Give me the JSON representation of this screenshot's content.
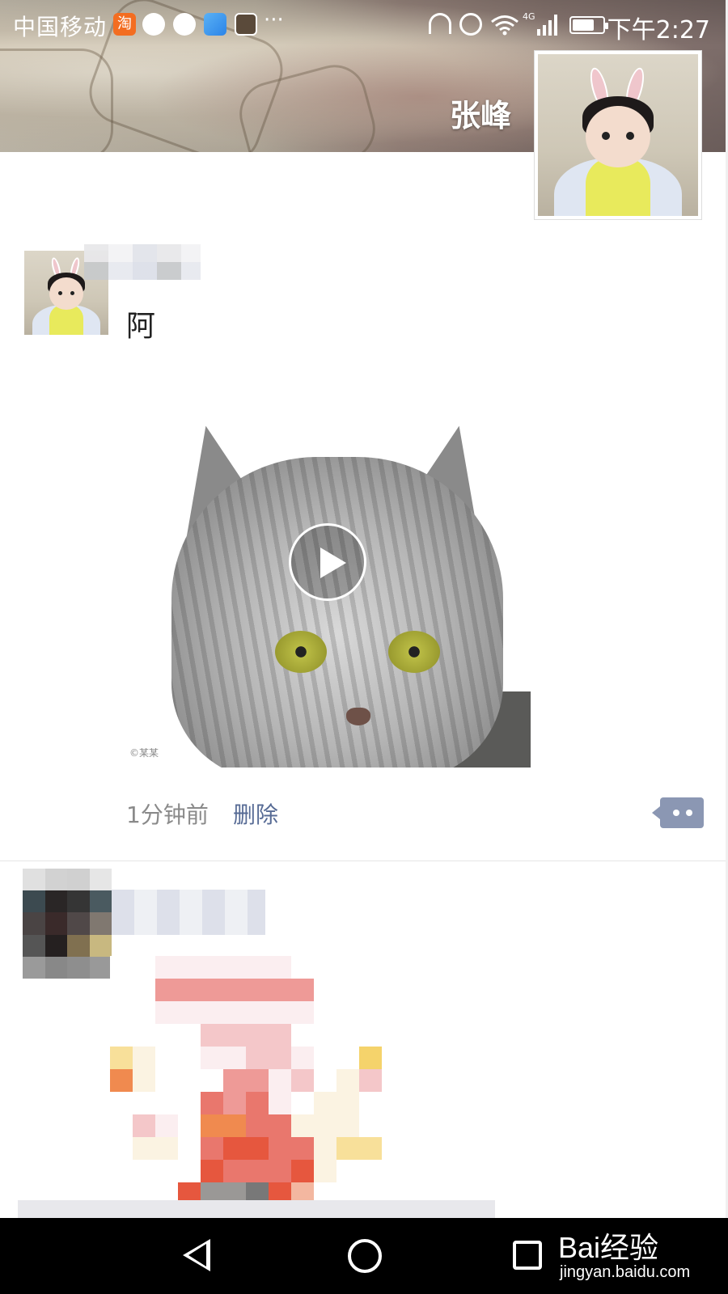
{
  "status_bar": {
    "carrier": "中国移动",
    "taobao_badge": "淘",
    "more": "···",
    "network": "4G",
    "time": "下午2:27"
  },
  "profile": {
    "name": "张峰"
  },
  "post": {
    "text": "阿",
    "time": "1分钟前",
    "delete_label": "删除",
    "video_watermark": "©某某"
  },
  "navbar": {
    "watermark_brand": "Bai经验",
    "watermark_url": "jingyan.baidu.com"
  },
  "colors": {
    "link": "#576b95",
    "comment_button": "#8b97b3",
    "nav_background": "#000000"
  },
  "icons": [
    "headset-icon",
    "alarm-icon",
    "wifi-icon",
    "signal-icon",
    "battery-icon",
    "play-icon",
    "comment-icon",
    "back-icon",
    "home-icon",
    "recent-apps-icon"
  ]
}
